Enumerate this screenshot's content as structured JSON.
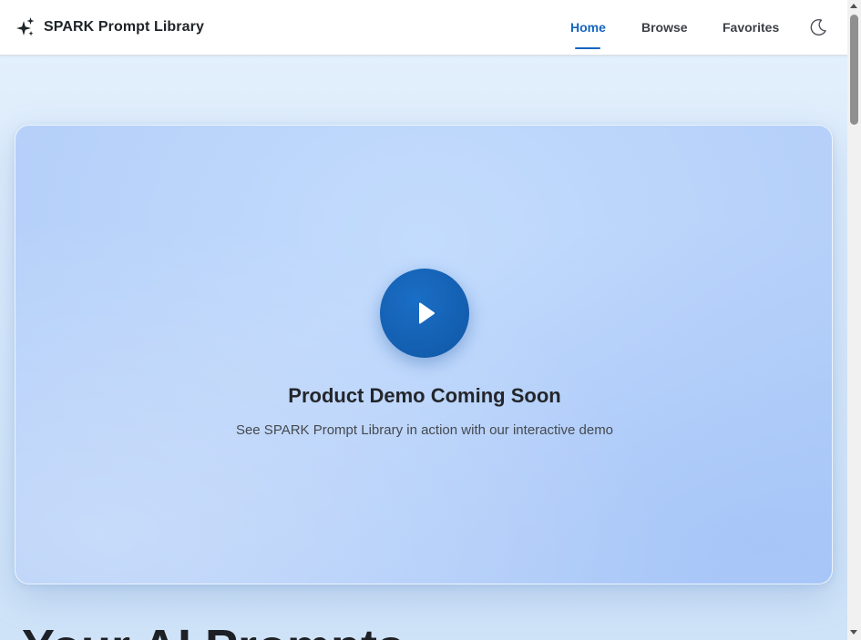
{
  "header": {
    "brand_title": "SPARK Prompt Library",
    "brand_icon": "sparkles-icon",
    "nav": [
      {
        "label": "Home",
        "active": true
      },
      {
        "label": "Browse",
        "active": false
      },
      {
        "label": "Favorites",
        "active": false
      }
    ],
    "theme_toggle_icon": "moon-icon"
  },
  "hero": {
    "play_icon": "play-icon",
    "title": "Product Demo Coming Soon",
    "subtitle": "See SPARK Prompt Library in action with our interactive demo"
  },
  "section": {
    "heading": "Your AI Prompts"
  },
  "colors": {
    "accent": "#1565c0",
    "play_button": "#1460b2",
    "hero_background": "#bcd6fb",
    "page_background": "#dcecfb"
  }
}
